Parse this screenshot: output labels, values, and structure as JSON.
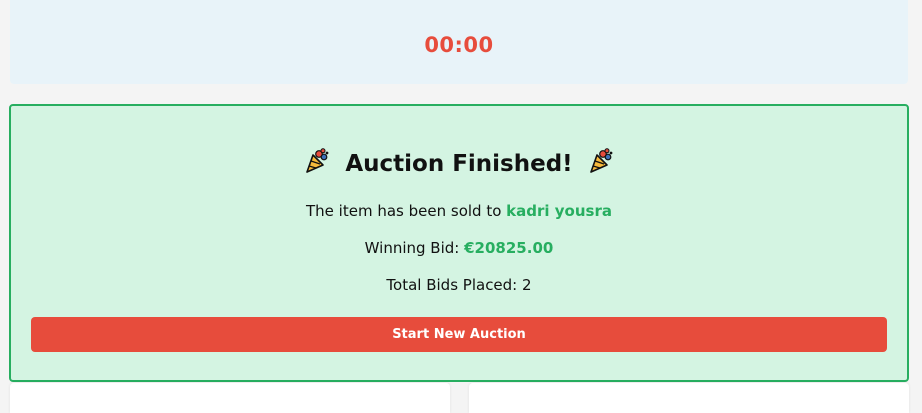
{
  "timer": {
    "value": "00:00"
  },
  "result": {
    "title": "Auction Finished!",
    "sold_prefix": "The item has been sold to",
    "winner_name": "kadri yousra",
    "winning_bid_label": "Winning Bid:",
    "winning_bid_value": "€20825.00",
    "total_bids_label": "Total Bids Placed:",
    "total_bids_value": "2",
    "left_icon": "party-popper-icon",
    "right_icon": "party-popper-icon"
  },
  "actions": {
    "start_new_auction_label": "Start New Auction"
  },
  "colors": {
    "accent_green": "#27ae60",
    "accent_red": "#e74c3c",
    "timer_background": "#e8f3f9",
    "result_background": "#d4f4e2"
  }
}
